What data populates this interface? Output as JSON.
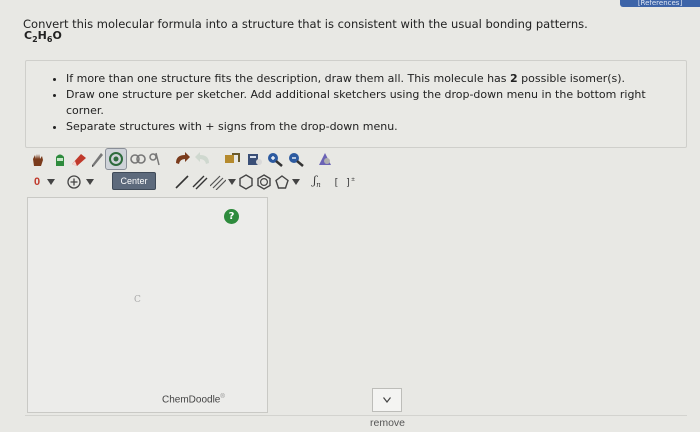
{
  "header": {
    "references_tab": "[References]"
  },
  "question": {
    "prompt": "Convert this molecular formula into a structure that is consistent with the usual bonding patterns.",
    "formula": {
      "c": "C",
      "c_sub": "2",
      "h": "H",
      "h_sub": "6",
      "o": "O"
    }
  },
  "instructions": {
    "item1_prefix": "If more than one structure fits the description, draw them all. This molecule has ",
    "item1_count": "2",
    "item1_suffix": " possible isomer(s).",
    "item2": "Draw one structure per sketcher. Add additional sketchers using the drop-down menu in the bottom right corner.",
    "item3": "Separate structures with + signs from the drop-down menu."
  },
  "toolbar": {
    "charge_value": "0",
    "center_label": "Center",
    "sn_label": "Sn",
    "bracket_label": "[ ]",
    "colors": {
      "hand": "#7a3b1c",
      "green": "#2e8b3d",
      "red": "#c0392b",
      "blue": "#2c5aa0",
      "grey": "#555555"
    }
  },
  "canvas": {
    "atom_label": "C",
    "help_label": "?",
    "brand": "ChemDoodle",
    "brand_mark": "®"
  },
  "controls": {
    "remove_label": "remove"
  }
}
